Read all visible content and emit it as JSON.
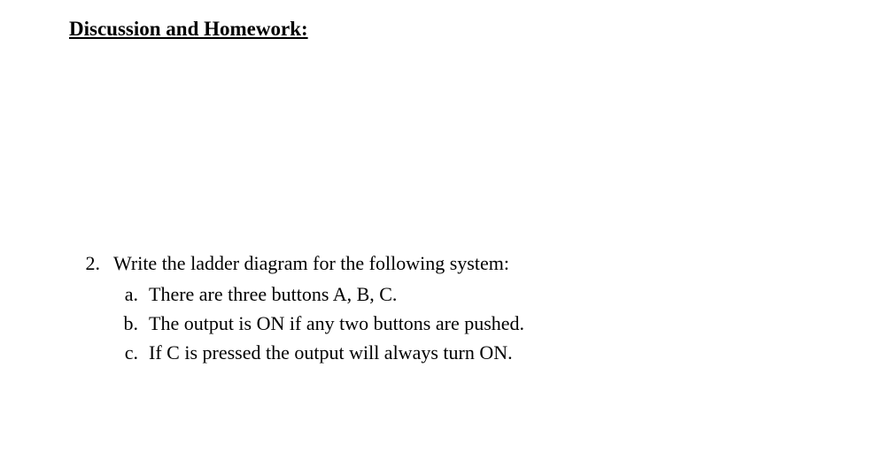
{
  "heading": "Discussion and Homework:",
  "question": {
    "number": "2.",
    "text": "Write the ladder diagram for the following system:",
    "subitems": [
      {
        "label": "a.",
        "text": "There are three buttons A, B, C."
      },
      {
        "label": "b.",
        "text": "The output is ON if any two buttons are pushed."
      },
      {
        "label": "c.",
        "text": "If C is pressed the output will always turn ON."
      }
    ]
  }
}
